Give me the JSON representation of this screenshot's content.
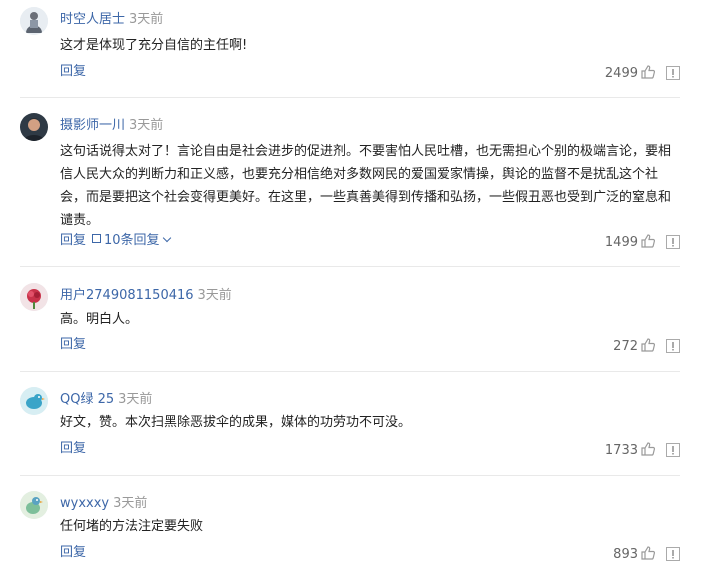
{
  "comments": [
    {
      "username": "时空人居士",
      "time": "3天前",
      "text": "这才是体现了充分自信的主任啊!",
      "reply_label": "回复",
      "likes": "2499",
      "avatar_icon": "buddha-figure-avatar"
    },
    {
      "username": "摄影师一川",
      "time": "3天前",
      "text": "这句话说得太对了！言论自由是社会进步的促进剂。不要害怕人民吐槽，也无需担心个别的极端言论，要相信人民大众的判断力和正义感，也要充分相信绝对多数网民的爱国爱家情操，舆论的监督不是扰乱这个社会，而是要把这个社会变得更美好。在这里，一些真善美得到传播和弘扬，一些假丑恶也受到广泛的窒息和谴责。",
      "reply_label": "回复",
      "replies_label": "10条回复",
      "likes": "1499",
      "avatar_icon": "man-portrait-avatar"
    },
    {
      "username": "用户2749081150416",
      "time": "3天前",
      "text": "高。明白人。",
      "reply_label": "回复",
      "likes": "272",
      "avatar_icon": "red-flower-avatar"
    },
    {
      "username": "QQ绿 25",
      "time": "3天前",
      "text": "好文，赞。本次扫黑除恶拔伞的成果，媒体的功劳功不可没。",
      "reply_label": "回复",
      "likes": "1733",
      "avatar_icon": "blue-bird-avatar"
    },
    {
      "username": "wyxxxy",
      "time": "3天前",
      "text": "任何堵的方法注定要失败",
      "reply_label": "回复",
      "likes": "893",
      "avatar_icon": "cartoon-bird-avatar"
    }
  ],
  "colors": {
    "username": "#3d67a8",
    "meta": "#999999",
    "divider": "#e9e9e9"
  }
}
